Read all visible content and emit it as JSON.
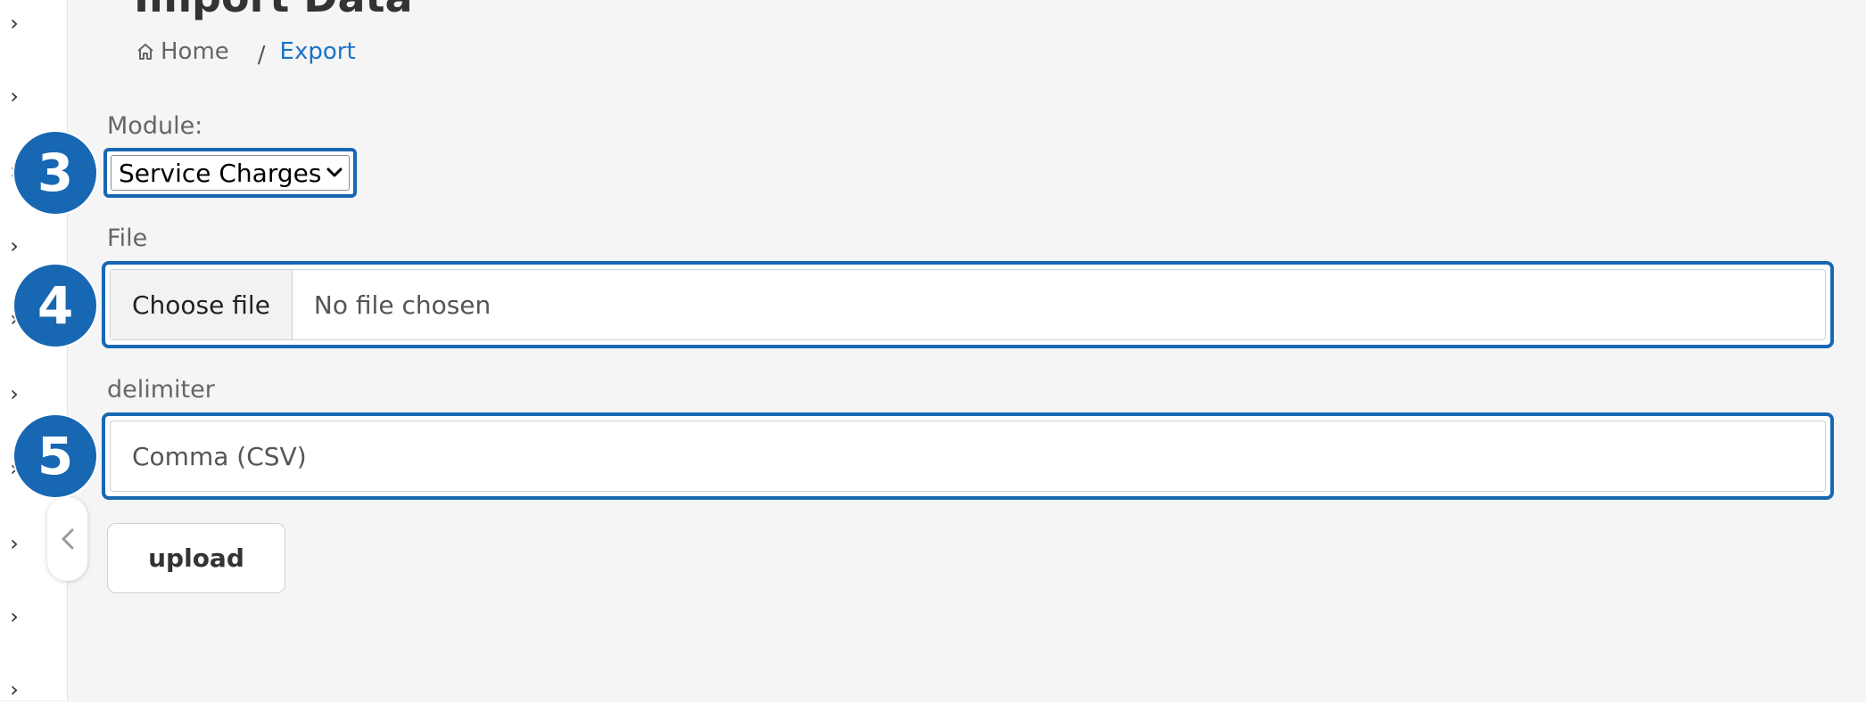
{
  "page": {
    "title": "Import Data"
  },
  "breadcrumb": {
    "home_label": "Home",
    "separator": "/",
    "current_label": "Export"
  },
  "form": {
    "module": {
      "label": "Module:",
      "selected": "Service Charges"
    },
    "file": {
      "label": "File",
      "button_label": "Choose file",
      "status": "No file chosen"
    },
    "delimiter": {
      "label": "delimiter",
      "value": "Comma (CSV)"
    },
    "upload_label": "upload"
  },
  "annotations": {
    "badge_module": "3",
    "badge_file": "4",
    "badge_delimiter": "5"
  },
  "colors": {
    "accent": "#1867b3",
    "link": "#1a73c8",
    "background": "#f5f5f5"
  }
}
